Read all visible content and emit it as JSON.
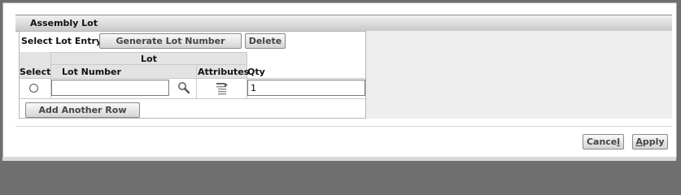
{
  "section": {
    "title": "Assembly Lot"
  },
  "lot_entry": {
    "label": "Select Lot Entry:",
    "generate_button": "Generate Lot Number",
    "delete_button": "Delete"
  },
  "table": {
    "group_header": "Lot",
    "columns": [
      "Select",
      "Lot Number",
      "Attributes",
      "Qty"
    ],
    "rows": [
      {
        "selected": false,
        "lot_number": "",
        "qty": "1"
      }
    ]
  },
  "add_row_button": "Add Another Row",
  "footer": {
    "cancel_prefix": "Cance",
    "cancel_access_key": "l",
    "apply_prefix": "",
    "apply_access_key": "A",
    "apply_suffix": "pply"
  },
  "icons": {
    "lot_search": "magnifier-icon",
    "attributes": "attributes-icon"
  }
}
